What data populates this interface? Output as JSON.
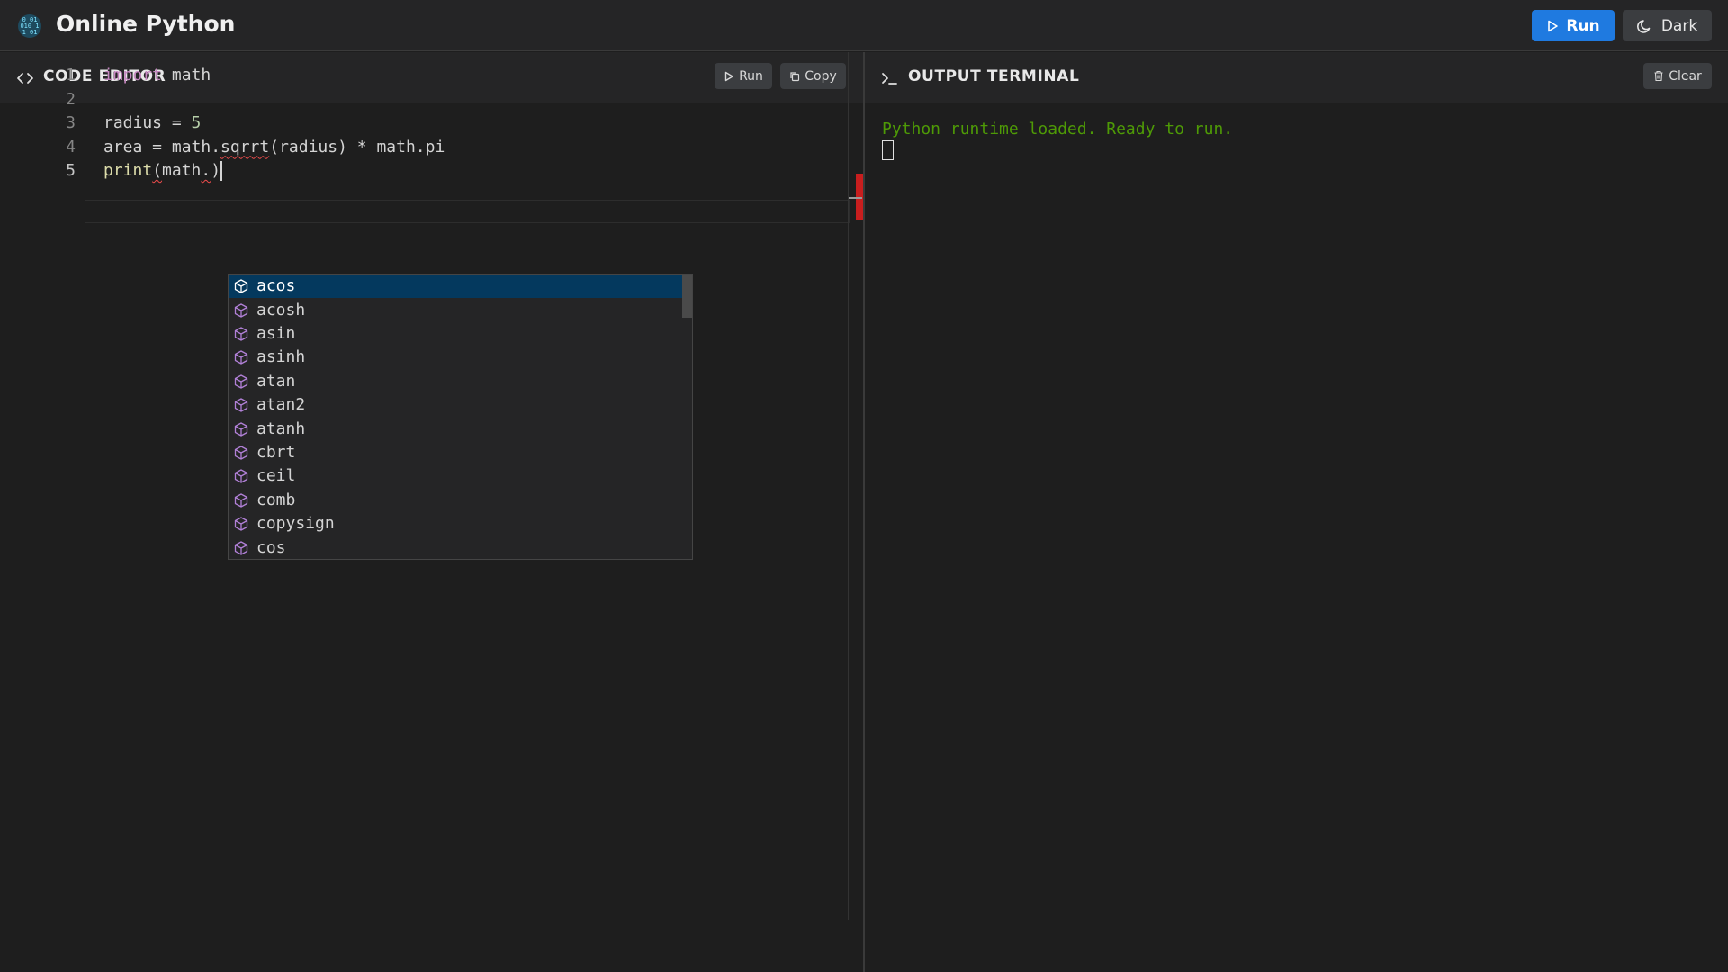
{
  "header": {
    "title": "Online Python",
    "run_label": "Run",
    "theme_label": "Dark",
    "logo_icon": "binary-head-logo",
    "accent": "#1f7ae0"
  },
  "editor": {
    "title": "CODE EDITOR",
    "run_label": "Run",
    "copy_label": "Copy",
    "lines": [
      {
        "number": "1",
        "parts": [
          {
            "t": "import",
            "c": "kw"
          },
          {
            "t": " math",
            "c": ""
          }
        ]
      },
      {
        "number": "2",
        "parts": []
      },
      {
        "number": "3",
        "parts": [
          {
            "t": "radius = ",
            "c": ""
          },
          {
            "t": "5",
            "c": "num"
          }
        ]
      },
      {
        "number": "4",
        "parts": [
          {
            "t": "area = math.",
            "c": ""
          },
          {
            "t": "sqrrt",
            "c": "squig"
          },
          {
            "t": "(radius) * math.pi",
            "c": ""
          }
        ]
      },
      {
        "number": "5",
        "parts": [
          {
            "t": "print",
            "c": "fn"
          },
          {
            "t": "(",
            "c": "squig"
          },
          {
            "t": "math",
            "c": ""
          },
          {
            "t": ".",
            "c": "squig"
          },
          {
            "t": ")",
            "c": ""
          }
        ]
      }
    ],
    "active_line": "5"
  },
  "suggestions": {
    "items": [
      "acos",
      "acosh",
      "asin",
      "asinh",
      "atan",
      "atan2",
      "atanh",
      "cbrt",
      "ceil",
      "comb",
      "copysign",
      "cos"
    ],
    "selected_index": 0,
    "item_icon": "module-cube-icon"
  },
  "output": {
    "title": "OUTPUT TERMINAL",
    "clear_label": "Clear",
    "text": "Python runtime loaded. Ready to run."
  }
}
